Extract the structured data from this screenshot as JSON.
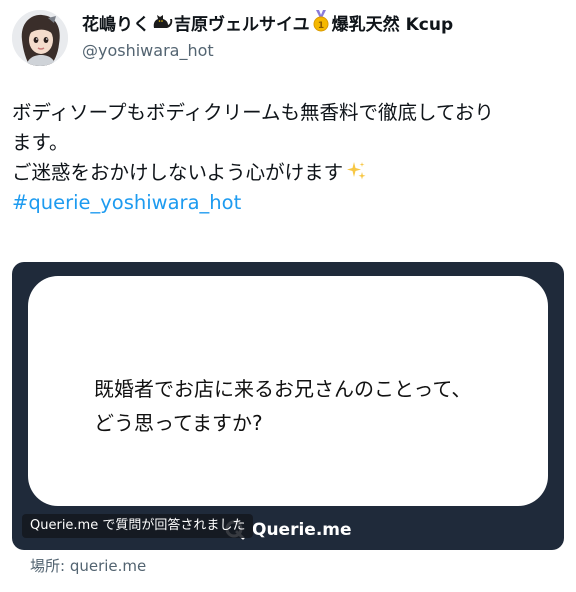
{
  "author": {
    "display_name_part1": "花嶋りく",
    "display_name_part2": "吉原ヴェルサイユ",
    "display_name_part3": "爆乳天然 Kcup",
    "handle": "@yoshiwara_hot",
    "icons": [
      "black-cat-icon",
      "medal-icon"
    ]
  },
  "tweet": {
    "line1": "ボディソープもボディクリームも無香料で徹底しており",
    "line2": "ます。",
    "line3": "ご迷惑をおかけしないよう心がけます",
    "hashtag": "#querie_yoshiwara_hot",
    "emoji": "sparkles-icon"
  },
  "card": {
    "question_line1": "既婚者でお店に来るお兄さんのことって、",
    "question_line2": "どう思ってますか?",
    "caption": "Querie.me で質問が回答されました",
    "brand": "Querie.me",
    "background_color": "#1f2a3a"
  },
  "location": {
    "text": "場所: querie.me"
  },
  "colors": {
    "link": "#1d9bf0",
    "secondary_text": "#536471",
    "primary_text": "#0f1419"
  }
}
